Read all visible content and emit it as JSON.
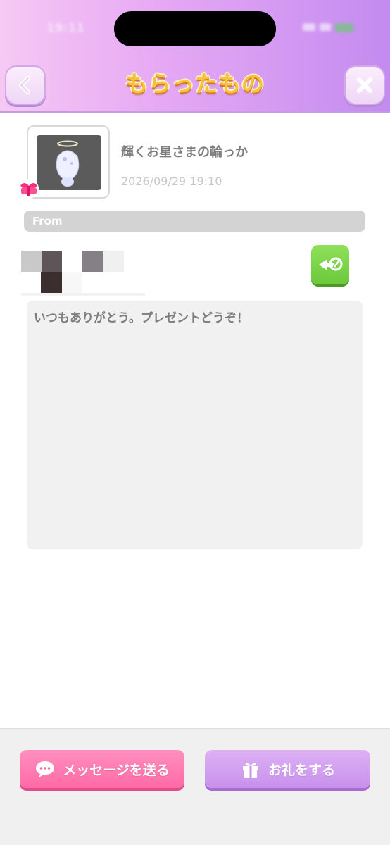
{
  "status_bar": {
    "time": "19:11"
  },
  "header": {
    "title": "もらったもの"
  },
  "item": {
    "name": "輝くお星さまの輪っか",
    "received_at": "2026/09/29 19:10"
  },
  "sender": {
    "section_label": "From"
  },
  "message": {
    "text": "いつもありがとう。プレゼントどうぞ！"
  },
  "footer": {
    "send_message_label": "メッセージを送る",
    "thanks_label": "お礼をする"
  },
  "colors": {
    "header_gradient_start": "#f6c9f4",
    "header_gradient_end": "#c38bf0",
    "title_color": "#f7c23e",
    "message_button": "#ff7ab0",
    "thanks_button": "#d3a2f0",
    "visit_button": "#7dd64a"
  },
  "icons": {
    "back": "chevron-left-icon",
    "close": "close-icon",
    "visit": "room-visit-icon",
    "chat": "chat-bubble-icon",
    "gift": "gift-icon",
    "badge": "ribbon-badge-icon"
  }
}
